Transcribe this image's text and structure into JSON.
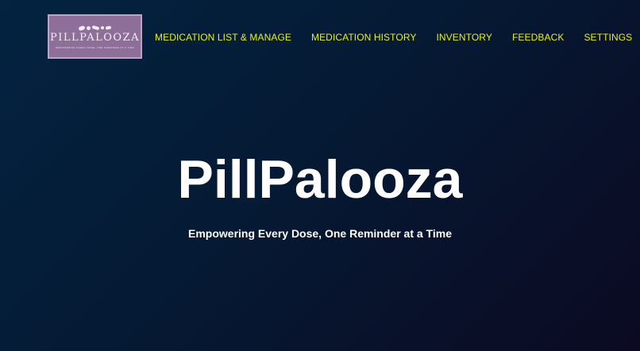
{
  "logo": {
    "name": "PILLPALOOZA",
    "tagline": "EMPOWERING EVERY DOSE, ONE REMINDER AT A TIME",
    "icon": "pills-logo-icon"
  },
  "nav": {
    "items": [
      {
        "label": "MEDICATION LIST & MANAGE"
      },
      {
        "label": "MEDICATION HISTORY"
      },
      {
        "label": "INVENTORY"
      },
      {
        "label": "FEEDBACK"
      },
      {
        "label": "SETTINGS"
      }
    ]
  },
  "hero": {
    "title": "PillPalooza",
    "subtitle": "Empowering Every Dose, One Reminder at a Time"
  },
  "colors": {
    "nav_link": "#e8ee1c",
    "background_start": "#032340",
    "background_end": "#0b0a22",
    "logo_bg": "#8d6f99",
    "text": "#ffffff"
  }
}
